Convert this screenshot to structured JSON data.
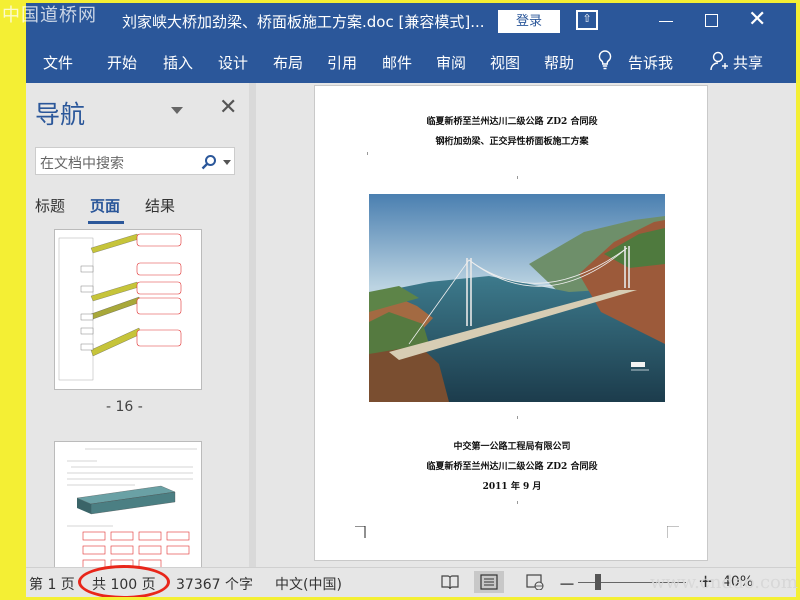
{
  "window": {
    "title": "刘家峡大桥加劲梁、桥面板施工方案.doc [兼容模式]...",
    "login_label": "登录",
    "close_glyph": "✕"
  },
  "menu": [
    "文件",
    "开始",
    "插入",
    "设计",
    "布局",
    "引用",
    "邮件",
    "审阅",
    "视图",
    "帮助"
  ],
  "tell_me": "告诉我",
  "share": "共享",
  "nav": {
    "title": "导航",
    "close_glyph": "✕",
    "search_placeholder": "在文档中搜索",
    "tabs": [
      "标题",
      "页面",
      "结果"
    ],
    "active_tab": "页面",
    "page_label": "- 16 -"
  },
  "document": {
    "lines_top": [
      "临夏新桥至兰州达川二级公路 ZD2 合同段",
      "钢桁加劲梁、正交异性桥面板施工方案"
    ],
    "lines_bottom": [
      "中交第一公路工程局有限公司",
      "临夏新桥至兰州达川二级公路 ZD2 合同段",
      "2011 年 9 月"
    ]
  },
  "status": {
    "page": "第 1 页",
    "total_pages": "共 100 页",
    "words": "37367 个字",
    "language": "中文(中国)",
    "zoom": "40%",
    "zoom_minus": "－",
    "zoom_plus": "+"
  },
  "watermarks": {
    "top_left": "中国道桥网",
    "bottom_right": "www.cndao.com"
  },
  "colors": {
    "accent": "#2b579a",
    "highlight": "#f4ef34",
    "annotation": "#e8261a"
  },
  "icons": [
    "bulb-icon",
    "person-icon",
    "search-icon",
    "chevron-down-icon",
    "read-mode-icon",
    "print-layout-icon",
    "web-layout-icon"
  ]
}
